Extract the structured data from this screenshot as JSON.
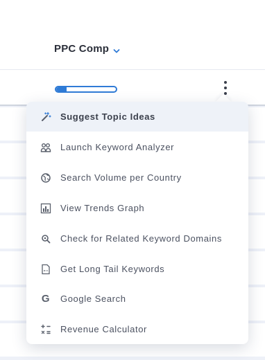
{
  "header": {
    "column_title": "PPC Comp"
  },
  "row": {
    "ppc_comp_progress_fraction": 0.17
  },
  "menu": {
    "items": [
      {
        "label": "Suggest Topic Ideas",
        "icon": "magic-wand-icon"
      },
      {
        "label": "Launch Keyword Analyzer",
        "icon": "users-icon"
      },
      {
        "label": "Search Volume per Country",
        "icon": "globe-icon"
      },
      {
        "label": "View Trends Graph",
        "icon": "bar-chart-icon"
      },
      {
        "label": "Check for Related Keyword Domains",
        "icon": "search-icon"
      },
      {
        "label": "Get Long Tail Keywords",
        "icon": "document-icon"
      },
      {
        "label": "Google Search",
        "icon": "google-icon"
      },
      {
        "label": "Revenue Calculator",
        "icon": "calculator-icon"
      }
    ]
  },
  "colors": {
    "accent": "#2f7bd6",
    "text": "#4b5160",
    "active_bg": "#eef2f8"
  }
}
